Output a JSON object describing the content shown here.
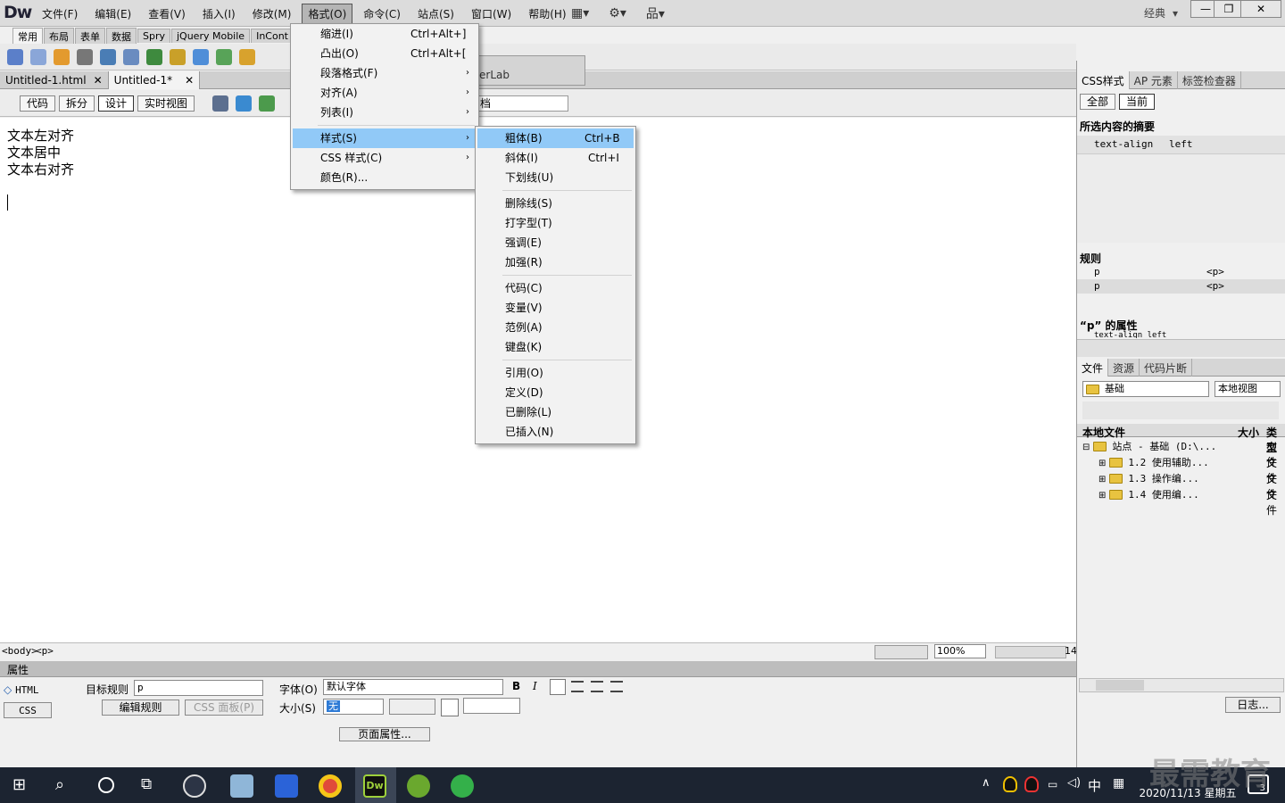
{
  "app": {
    "logo": "Dw",
    "mode": "经典",
    "mode_arrow": "▾"
  },
  "menubar": [
    {
      "label": "文件(F)"
    },
    {
      "label": "编辑(E)"
    },
    {
      "label": "查看(V)"
    },
    {
      "label": "插入(I)"
    },
    {
      "label": "修改(M)"
    },
    {
      "label": "格式(O)",
      "active": true
    },
    {
      "label": "命令(C)"
    },
    {
      "label": "站点(S)"
    },
    {
      "label": "窗口(W)"
    },
    {
      "label": "帮助(H)"
    }
  ],
  "window_buttons": {
    "minimize": "—",
    "restore": "❐",
    "close": "✕"
  },
  "insert_tabs": [
    "常用",
    "布局",
    "表单",
    "数据",
    "Spry",
    "jQuery Mobile",
    "InCont"
  ],
  "doc_tabs": [
    {
      "label": "Untitled-1.html",
      "close": "✕"
    },
    {
      "label": "Untitled-1*",
      "close": "✕"
    }
  ],
  "view_buttons": [
    "代码",
    "拆分",
    "设计",
    "实时视图"
  ],
  "doc_title_field": "档",
  "floating_panel_tab": "erLab",
  "document": {
    "lines": [
      "文本左对齐",
      "文本居中",
      "文本右对齐"
    ]
  },
  "statusbar": {
    "tag1": "<body>",
    "tag2": "<p>",
    "zoom": "100%",
    "size": "14"
  },
  "properties": {
    "header": "属性",
    "html_btn": "HTML",
    "css_btn": "CSS",
    "target_rule_label": "目标规则",
    "target_rule_value": "p",
    "edit_rule_btn": "编辑规则",
    "css_panel_btn": "CSS 面板(P)",
    "font_label": "字体(O)",
    "font_value": "默认字体",
    "size_label": "大小(S)",
    "size_value": "无",
    "bold": "B",
    "italic": "I",
    "page_props_btn": "页面属性..."
  },
  "css_panel": {
    "tabs": [
      "CSS样式",
      "AP 元素",
      "标签检查器"
    ],
    "subtabs": [
      "全部",
      "当前"
    ],
    "summary_title": "所选内容的摘要",
    "summary_prop": "text-align",
    "summary_val": "left",
    "rules_title": "规则",
    "rules": [
      {
        "sel": "p",
        "tag": "<p>"
      },
      {
        "sel": "p",
        "tag": "<p>"
      }
    ],
    "props_title": "“p” 的属性",
    "props_row": "text-align  left"
  },
  "files_panel": {
    "tabs": [
      "文件",
      "资源",
      "代码片断"
    ],
    "site": "基础",
    "view": "本地视图",
    "col_local": "本地文件",
    "col_size": "大小",
    "col_type": "类型",
    "tree": [
      {
        "label": "站点 - 基础 (D:\\...",
        "type": "文件"
      },
      {
        "label": "1.2 使用辅助...",
        "type": "文件"
      },
      {
        "label": "1.3  操作编...",
        "type": "文件"
      },
      {
        "label": "1.4  使用编...",
        "type": "文件"
      }
    ],
    "log_btn": "日志..."
  },
  "format_menu": [
    {
      "label": "缩进(I)",
      "shortcut": "Ctrl+Alt+]"
    },
    {
      "label": "凸出(O)",
      "shortcut": "Ctrl+Alt+["
    },
    {
      "label": "段落格式(F)",
      "arrow": "›"
    },
    {
      "label": "对齐(A)",
      "arrow": "›"
    },
    {
      "label": "列表(I)",
      "arrow": "›"
    },
    {
      "label": "样式(S)",
      "arrow": "›"
    },
    {
      "label": "CSS 样式(C)",
      "arrow": "›"
    },
    {
      "label": "颜色(R)..."
    }
  ],
  "style_menu": [
    {
      "label": "粗体(B)",
      "shortcut": "Ctrl+B"
    },
    {
      "label": "斜体(I)",
      "shortcut": "Ctrl+I"
    },
    {
      "label": "下划线(U)"
    },
    {
      "label": "删除线(S)"
    },
    {
      "label": "打字型(T)"
    },
    {
      "label": "强调(E)"
    },
    {
      "label": "加强(R)"
    },
    {
      "label": "代码(C)"
    },
    {
      "label": "变量(V)"
    },
    {
      "label": "范例(A)"
    },
    {
      "label": "键盘(K)"
    },
    {
      "label": "引用(O)"
    },
    {
      "label": "定义(D)"
    },
    {
      "label": "已删除(L)"
    },
    {
      "label": "已插入(N)"
    }
  ],
  "taskbar": {
    "ime": "中",
    "date": "2020/11/13 星期五",
    "notify": "3"
  },
  "watermark": "最需教育"
}
